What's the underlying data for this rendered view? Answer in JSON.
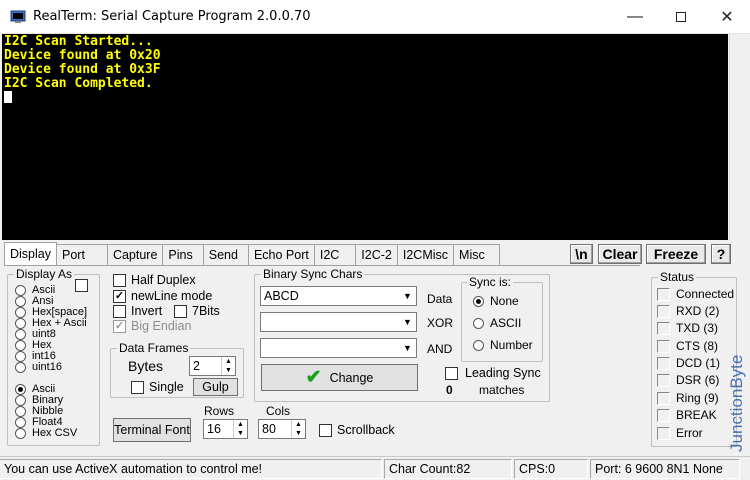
{
  "window": {
    "title": "RealTerm: Serial Capture Program 2.0.0.70",
    "minimize_icon": "minimize-icon",
    "maximize_icon": "maximize-icon",
    "close_icon": "close-icon"
  },
  "terminal": {
    "lines": [
      "I2C Scan Started...",
      "Device found at 0x20",
      "Device found at 0x3F",
      "I2C Scan Completed."
    ],
    "text_color": "#ffff00",
    "background": "#000000"
  },
  "tabs": [
    "Display",
    "Port",
    "Capture",
    "Pins",
    "Send",
    "Echo Port",
    "I2C",
    "I2C-2",
    "I2CMisc",
    "Misc"
  ],
  "active_tab": "Display",
  "toolbar": {
    "newline_label": "\\n",
    "clear_label": "Clear",
    "freeze_label": "Freeze",
    "help_label": "?"
  },
  "display_as": {
    "label": "Display As",
    "options": [
      "Ascii",
      "Ansi",
      "Hex[space]",
      "Hex + Ascii",
      "uint8",
      "Hex",
      "int16",
      "uint16",
      "Ascii",
      "Binary",
      "Nibble",
      "Float4",
      "Hex CSV"
    ],
    "selected_index": 8
  },
  "options": {
    "half_duplex": "Half Duplex",
    "newline_mode": "newLine mode",
    "invert": "Invert",
    "seven_bits": "7Bits",
    "big_endian": "Big Endian"
  },
  "data_frames": {
    "label": "Data Frames",
    "bytes_label": "Bytes",
    "bytes_value": "2",
    "single_label": "Single",
    "gulp_label": "Gulp"
  },
  "terminal_font_label": "Terminal Font",
  "rows": {
    "label": "Rows",
    "value": "16"
  },
  "cols": {
    "label": "Cols",
    "value": "80"
  },
  "scrollback_label": "Scrollback",
  "binary_sync": {
    "label": "Binary Sync Chars",
    "data_value": "ABCD",
    "data_label": "Data",
    "xor_label": "XOR",
    "and_label": "AND",
    "change_label": "Change",
    "leading_sync_label": "Leading Sync",
    "matches_label": "matches",
    "matches_count": "0",
    "sync_is": {
      "label": "Sync is:",
      "options": [
        "None",
        "ASCII",
        "Number"
      ],
      "selected": "None"
    }
  },
  "status": {
    "label": "Status",
    "items": [
      "Connected",
      "RXD (2)",
      "TXD (3)",
      "CTS (8)",
      "DCD (1)",
      "DSR (6)",
      "Ring (9)",
      "BREAK",
      "Error"
    ]
  },
  "statusbar": {
    "message": "You can use ActiveX automation to control me!",
    "char_count": "Char Count:82",
    "cps": "CPS:0",
    "port": "Port: 6 9600 8N1 None"
  },
  "watermark": "JunctionByte",
  "colors": {
    "change_check": "#1aa01a",
    "watermark": "#2a5da8"
  }
}
